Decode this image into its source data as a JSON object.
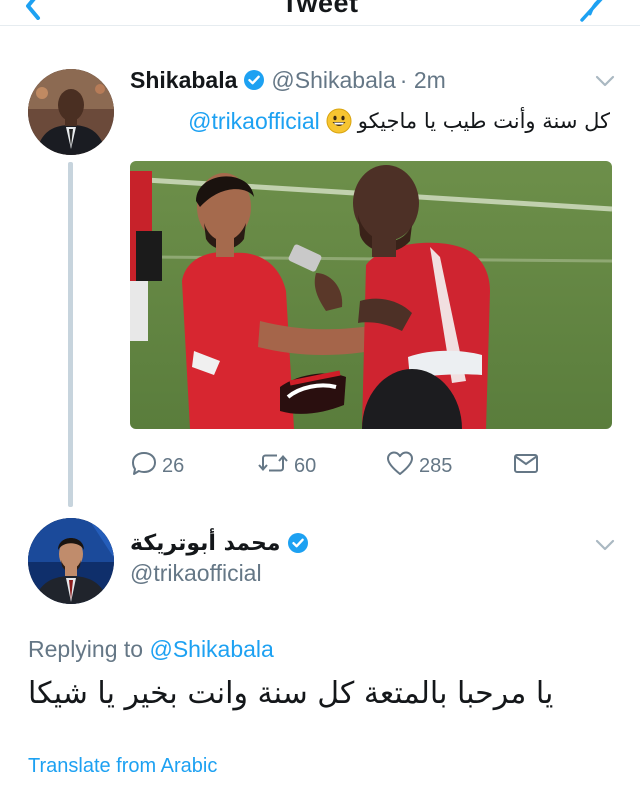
{
  "topbar": {
    "title": "Tweet",
    "back_icon": "chevron-left-icon",
    "compose_icon": "compose-feather-icon",
    "accent_color": "#1da1f2"
  },
  "tweet1": {
    "display_name": "Shikabala",
    "handle": "@Shikabala",
    "time": "· 2m",
    "verified": true,
    "text_arabic": "كل سنة وأنت طيب يا ماجيكو",
    "emoji": "grinning-face-emoji",
    "mention": "@trikaofficial",
    "image_description_icon": "photo-two-players-red-kit",
    "actions": {
      "replies": "26",
      "retweets": "60",
      "likes": "285"
    }
  },
  "tweet2": {
    "display_name": "محمد أبوتريكة",
    "handle": "@trikaofficial",
    "verified": true,
    "replying_prefix": "Replying to",
    "replying_to": "@Shikabala",
    "text_arabic": "يا مرحبا بالمتعة كل سنة وانت بخير يا شيكا",
    "translate_label": "Translate from Arabic"
  },
  "colors": {
    "link": "#1da1f2",
    "muted": "#657786",
    "text": "#14171a",
    "divider": "#e6ecf0",
    "thread_line": "#c7d4dd"
  }
}
